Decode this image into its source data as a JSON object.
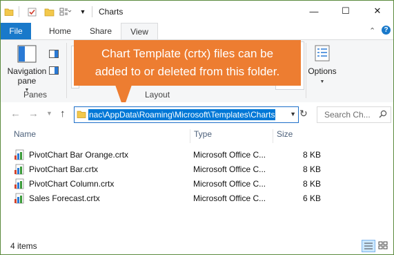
{
  "window": {
    "title": "Charts",
    "controls": {
      "minimize": "—",
      "maximize": "☐",
      "close": "✕"
    }
  },
  "ribbon": {
    "tabs": [
      {
        "label": "File"
      },
      {
        "label": "Home"
      },
      {
        "label": "Share"
      },
      {
        "label": "View"
      }
    ],
    "active_tab": "View",
    "panes_group": {
      "navigation_pane_label_line1": "Navigation",
      "navigation_pane_label_line2": "pane",
      "group_label": "Panes"
    },
    "layout_group_label": "Layout",
    "current_view_fragment": "w",
    "options_label": "Options"
  },
  "callout": {
    "line1": "Chart Template (crtx) files can be",
    "line2": "added to or deleted from this folder.",
    "color": "#ed7d31"
  },
  "navigation": {
    "back": "←",
    "forward": "→",
    "up": "↑",
    "address_path": "nac\\AppData\\Roaming\\Microsoft\\Templates\\Charts",
    "search_placeholder": "Search Ch..."
  },
  "file_list": {
    "columns": {
      "name": "Name",
      "type": "Type",
      "size": "Size"
    },
    "rows": [
      {
        "name": "PivotChart Bar Orange.crtx",
        "type": "Microsoft Office C...",
        "size": "8 KB"
      },
      {
        "name": "PivotChart Bar.crtx",
        "type": "Microsoft Office C...",
        "size": "8 KB"
      },
      {
        "name": "PivotChart Column.crtx",
        "type": "Microsoft Office C...",
        "size": "8 KB"
      },
      {
        "name": "Sales Forecast.crtx",
        "type": "Microsoft Office C...",
        "size": "6 KB"
      }
    ]
  },
  "status": {
    "item_count": "4 items"
  },
  "colors": {
    "accent": "#1979ca",
    "selection": "#0078d7",
    "border": "#5a8a3c"
  }
}
